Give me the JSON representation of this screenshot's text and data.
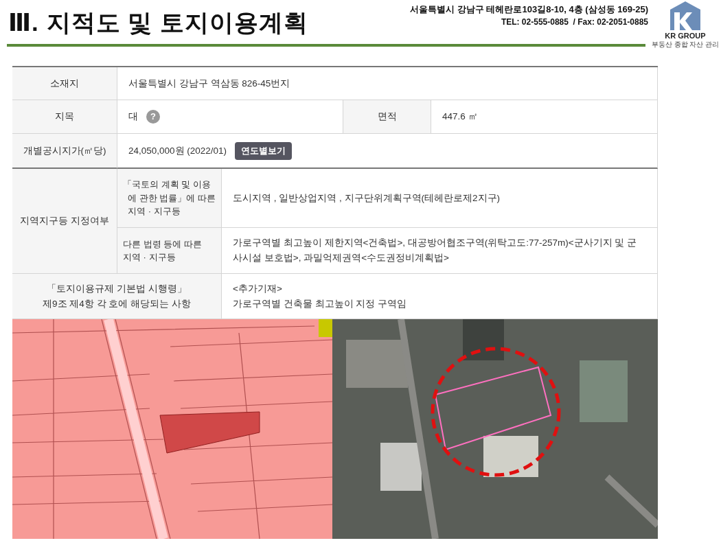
{
  "header": {
    "title": "Ⅲ. 지적도 및 토지이용계획",
    "address": "서울특별시 강남구 테헤란로103길8-10, 4층 (삼성동 169-25)",
    "contact": "TEL: 02-555-0885  / Fax: 02-2051-0885",
    "logo": {
      "name": "KR GROUP",
      "tagline": "부동산 종합 자산 관리"
    }
  },
  "land_info": {
    "location": {
      "label": "소재지",
      "value": "서울특별시 강남구 역삼동 826-45번지"
    },
    "category": {
      "label": "지목",
      "value": "대",
      "help": "?"
    },
    "area": {
      "label": "면적",
      "value": "447.6 ㎡"
    },
    "official_price": {
      "label": "개별공시지가(㎡당)",
      "value": "24,050,000원 (2022/01)",
      "button": "연도별보기"
    },
    "zoning": {
      "label": "지역지구등 지정여부",
      "items": [
        {
          "label": "「국토의 계획 및 이용\n  에 관한 법률」에 따른\n  지역 · 지구등",
          "value": "도시지역 , 일반상업지역 , 지구단위계획구역(테헤란로제2지구)"
        },
        {
          "label": "다른 법령 등에 따른\n지역 · 지구등",
          "value": "가로구역별 최고높이 제한지역<건축법>, 대공방어협조구역(위탁고도:77-257m)<군사기지 및 군사시설 보호법>, 과밀억제권역<수도권정비계획법>"
        }
      ]
    },
    "regulation": {
      "label": "「토지이용규제 기본법 시행령」\n제9조 제4항 각 호에 해당되는 사항",
      "value": "<추가기재>\n가로구역별 건축물 최고높이 지정 구역임"
    }
  }
}
